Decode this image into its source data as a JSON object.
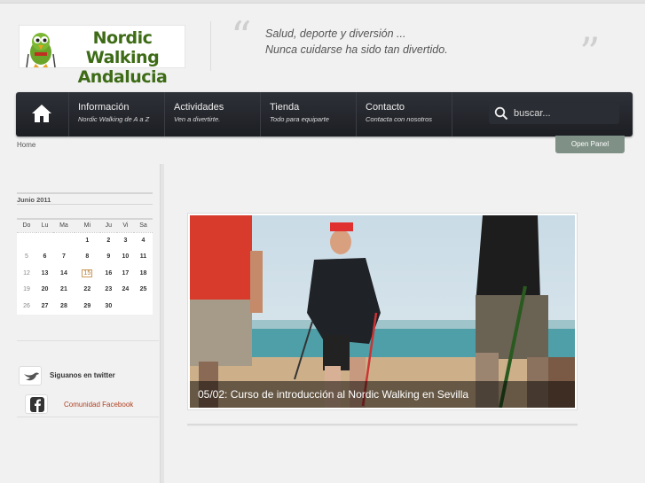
{
  "site": {
    "logo_line1": "Nordic Walking",
    "logo_line2": "Andalucia",
    "slogan_line1": "Salud, deporte y diversión ...",
    "slogan_line2": "Nunca cuidarse ha sido tan divertido.",
    "accent_color": "#3d6b16"
  },
  "nav": {
    "home_icon": "home-icon",
    "items": [
      {
        "title": "Información",
        "subtitle": "Nordic Walking de A a Z"
      },
      {
        "title": "Actividades",
        "subtitle": "Ven a divertirte."
      },
      {
        "title": "Tienda",
        "subtitle": "Todo para equiparte"
      },
      {
        "title": "Contacto",
        "subtitle": "Contacta con nosotros"
      }
    ],
    "search_placeholder": "buscar..."
  },
  "breadcrumb": "Home",
  "open_panel": "Open Panel",
  "calendar": {
    "title": "Junio 2011",
    "days": [
      "Do",
      "Lu",
      "Ma",
      "Mi",
      "Ju",
      "Vi",
      "Sa"
    ],
    "weeks": [
      [
        "",
        "",
        "",
        "1",
        "2",
        "3",
        "4"
      ],
      [
        "5",
        "6",
        "7",
        "8",
        "9",
        "10",
        "11"
      ],
      [
        "12",
        "13",
        "14",
        "15",
        "16",
        "17",
        "18"
      ],
      [
        "19",
        "20",
        "21",
        "22",
        "23",
        "24",
        "25"
      ],
      [
        "26",
        "27",
        "28",
        "29",
        "30",
        "",
        ""
      ]
    ],
    "today": "15"
  },
  "social": {
    "twitter_label": "Siguanos en twitter",
    "facebook_label": "Comunidad Facebook"
  },
  "slider": {
    "caption": "05/02: Curso de introducción al Nordic Walking en Sevilla"
  }
}
